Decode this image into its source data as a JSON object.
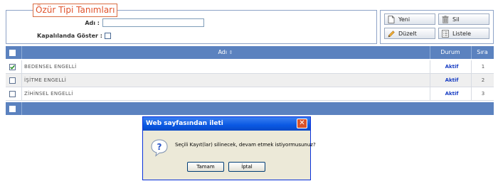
{
  "form": {
    "title": "Özür Tipi Tanımları",
    "name_label": "Adı :",
    "name_value": "",
    "show_closed_label": "Kapalılanda Göster :",
    "show_closed_checked": false
  },
  "toolbar": {
    "new_label": "Yeni",
    "delete_label": "Sil",
    "edit_label": "Düzelt",
    "list_label": "Listele"
  },
  "grid": {
    "columns": {
      "name": "Adı",
      "status": "Durum",
      "order": "Sıra"
    },
    "rows": [
      {
        "name": "BEDENSEL ENGELLİ",
        "status": "Aktif",
        "order": "1",
        "checked": true
      },
      {
        "name": "İŞİTME ENGELLİ",
        "status": "Aktif",
        "order": "2",
        "checked": false
      },
      {
        "name": "ZİHİNSEL ENGELLİ",
        "status": "Aktif",
        "order": "3",
        "checked": false
      }
    ]
  },
  "dialog": {
    "title": "Web sayfasından ileti",
    "message": "Seçili Kayıt(lar) silinecek, devam etmek istiyormusunuz?",
    "ok_label": "Tamam",
    "cancel_label": "İptal",
    "icon": "question-icon"
  }
}
